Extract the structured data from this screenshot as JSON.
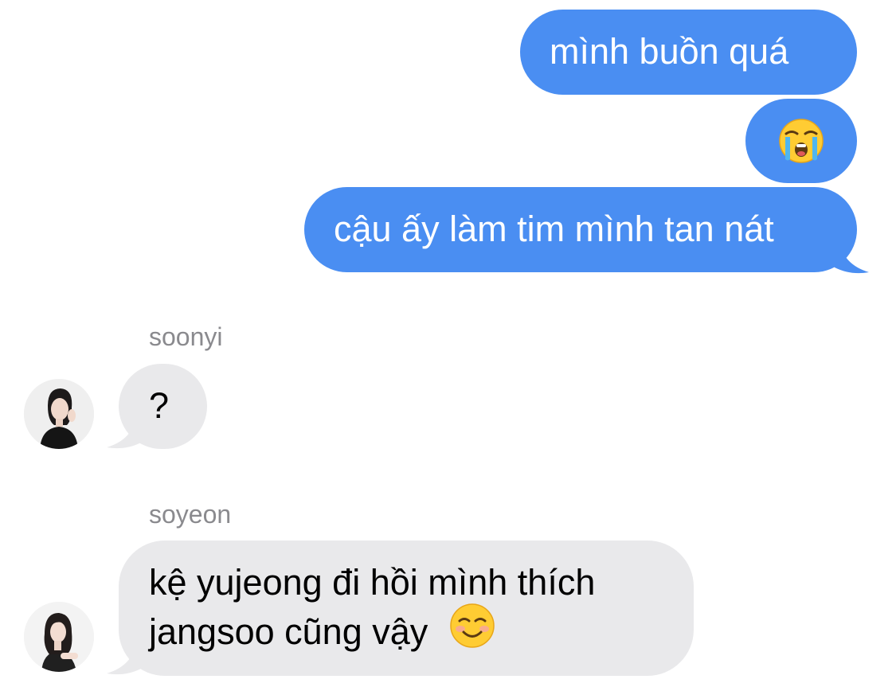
{
  "messages": {
    "sent": [
      {
        "text": "mình buồn quá"
      },
      {
        "emoji": "loudly-crying-face"
      },
      {
        "text": "cậu ấy làm tim mình tan nát"
      }
    ],
    "soonyi": {
      "sender": "soonyi",
      "text": "?",
      "avatar": "soonyi-avatar"
    },
    "soyeon": {
      "sender": "soyeon",
      "line1": "kệ yujeong đi hồi mình thích",
      "line2": "jangsoo cũng vậy",
      "emoji": "smiling-face",
      "avatar": "soyeon-avatar"
    }
  },
  "colors": {
    "sent_bubble": "#4a8ef2",
    "received_bubble": "#e9e9eb",
    "sender_name": "#8a8a8e"
  }
}
